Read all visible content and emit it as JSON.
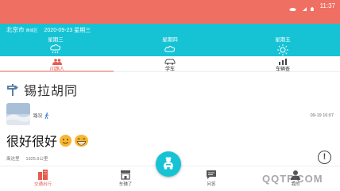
{
  "status_bar": {
    "time": "11:37",
    "icons": [
      "wifi-icon",
      "signal-icon",
      "battery-icon"
    ],
    "color": "#ef6f63"
  },
  "weather": {
    "city": "北京市",
    "district": "西城区",
    "date": "2020-09-23 星期三",
    "days": [
      {
        "name": "星期三",
        "icon": "rain-cloud-icon"
      },
      {
        "name": "星期四",
        "icon": "cloud-icon"
      },
      {
        "name": "星期五",
        "icon": "sun-icon"
      }
    ],
    "color": "#16c3d4"
  },
  "tabs": [
    {
      "label": "问路人",
      "icon": "people-icon",
      "active": true
    },
    {
      "label": "学车",
      "icon": "car-icon",
      "active": false
    },
    {
      "label": "车辆查",
      "icon": "chart-icon",
      "active": false
    }
  ],
  "section": {
    "title": "锡拉胡同"
  },
  "post": {
    "username": "路况",
    "timestamp": "09-19 16:07",
    "content": "很好很好",
    "emojis": [
      "smile-emoji",
      "grin-emoji"
    ],
    "meta": [
      "离这里",
      "1925.9公里"
    ]
  },
  "bottom_nav": [
    {
      "label": "交通出行",
      "icon": "building-icon",
      "active": true
    },
    {
      "label": "车辅了",
      "icon": "shop-icon",
      "active": false
    },
    {
      "label": "问答",
      "icon": "chat-icon",
      "active": false
    },
    {
      "label": "我的",
      "icon": "user-icon",
      "active": false
    }
  ],
  "watermark": "QQTF.COM"
}
